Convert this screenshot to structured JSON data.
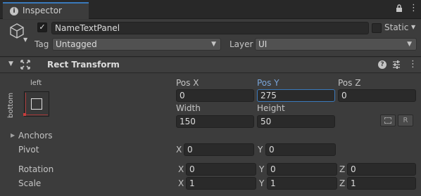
{
  "tab": {
    "icon": "info-icon",
    "label": "Inspector",
    "lock_icon": "lock-icon",
    "menu_icon": "kebab-menu-icon"
  },
  "gameobject": {
    "active": true,
    "name": "NameTextPanel",
    "static_label": "Static",
    "static_checked": false,
    "tag_label": "Tag",
    "tag_value": "Untagged",
    "layer_label": "Layer",
    "layer_value": "UI"
  },
  "component": {
    "title": "Rect Transform",
    "icons": [
      "rect-transform-icon",
      "help-icon",
      "preset-sliders-icon",
      "kebab-menu-icon"
    ]
  },
  "anchor_preset": {
    "top_label": "left",
    "side_label": "bottom"
  },
  "position": {
    "pos_x_label": "Pos X",
    "pos_x": "0",
    "pos_y_label": "Pos Y",
    "pos_y": "275",
    "pos_z_label": "Pos Z",
    "pos_z": "0"
  },
  "size": {
    "width_label": "Width",
    "width": "150",
    "height_label": "Height",
    "height": "50",
    "blueprint_button": "",
    "raw_button": "R"
  },
  "anchors": {
    "label": "Anchors"
  },
  "pivot": {
    "label": "Pivot",
    "x_label": "X",
    "x": "0",
    "y_label": "Y",
    "y": "0"
  },
  "rotation": {
    "label": "Rotation",
    "x_label": "X",
    "x": "0",
    "y_label": "Y",
    "y": "0",
    "z_label": "Z",
    "z": "0"
  },
  "scale": {
    "label": "Scale",
    "x_label": "X",
    "x": "1",
    "y_label": "Y",
    "y": "1",
    "z_label": "Z",
    "z": "1"
  },
  "colors": {
    "accent": "#3a79bb",
    "focused_label": "#7aa5d9",
    "panel_bg": "#3c3c3c",
    "field_bg": "#2a2a2a"
  }
}
